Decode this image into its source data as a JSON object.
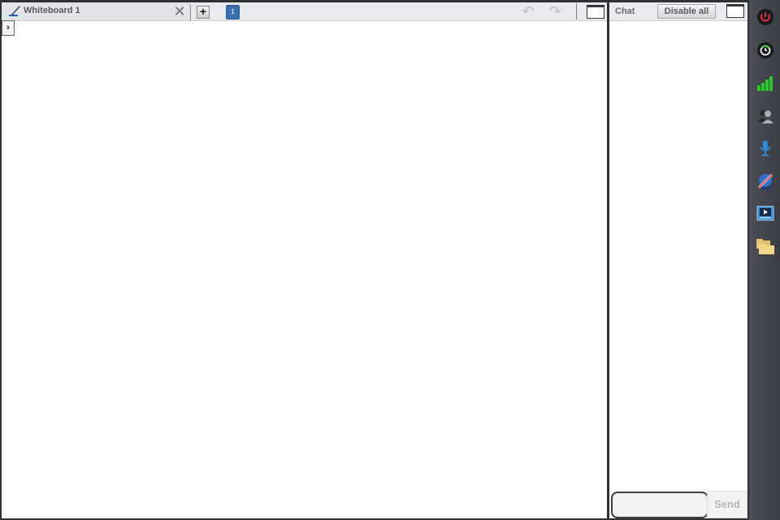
{
  "whiteboard": {
    "tab_label": "Whiteboard 1",
    "close_glyph": "✕",
    "add_tab_glyph": "+",
    "page_number": "1",
    "undo_glyph": "↶",
    "redo_glyph": "↷",
    "expand_glyph": "›"
  },
  "chat": {
    "title": "Chat",
    "disable_all_label": "Disable all",
    "input_value": "",
    "input_placeholder": "",
    "send_label": "Send"
  },
  "dock": {
    "items": [
      {
        "name": "power",
        "color": "#e0303a"
      },
      {
        "name": "clock",
        "color": "#ffffff"
      },
      {
        "name": "signal",
        "color": "#28c828"
      },
      {
        "name": "participants",
        "color": "#9aa0a8"
      },
      {
        "name": "microphone",
        "color": "#2f8fdc"
      },
      {
        "name": "camera-disabled",
        "color": "#2f6fc8"
      },
      {
        "name": "media-player",
        "color": "#2f8fdc"
      },
      {
        "name": "files",
        "color": "#f0d080"
      }
    ]
  }
}
